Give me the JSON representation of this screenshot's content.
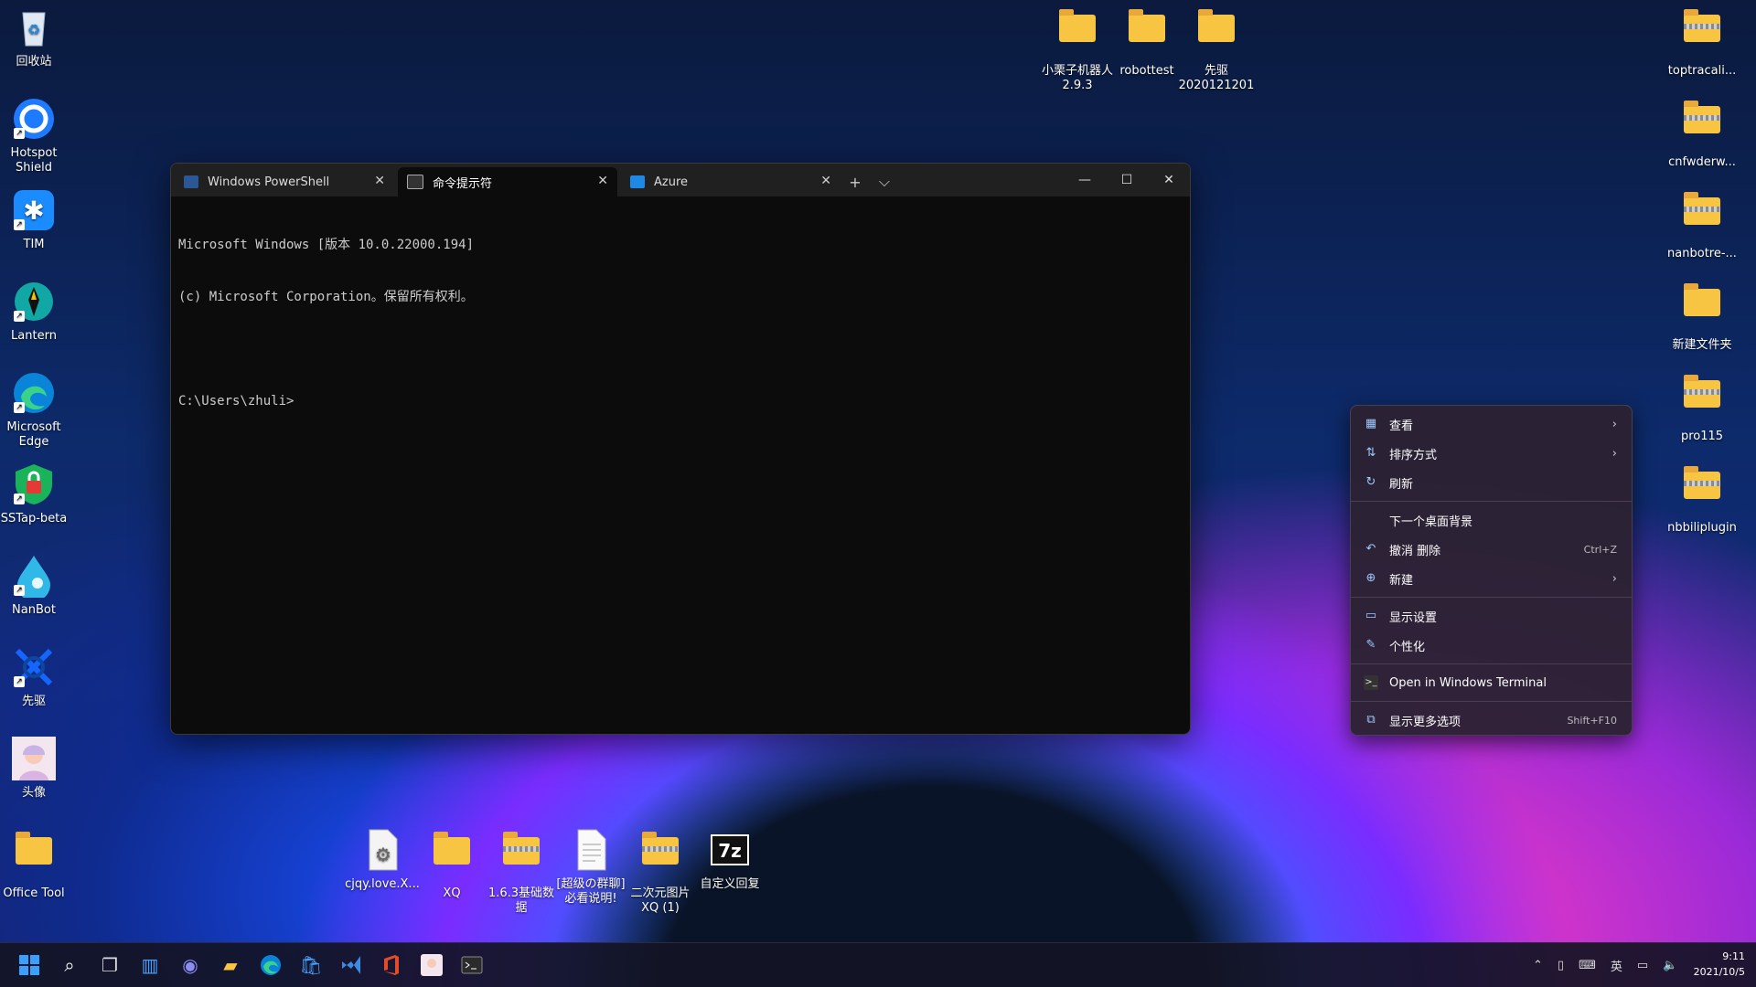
{
  "desktop": {
    "left_icons": [
      {
        "label": "回收站",
        "icon": "recycle-bin-icon"
      },
      {
        "label": "Hotspot\nShield",
        "icon": "hotspot-shield-icon"
      },
      {
        "label": "TIM",
        "icon": "tim-icon"
      },
      {
        "label": "Lantern",
        "icon": "lantern-icon"
      },
      {
        "label": "Microsoft\nEdge",
        "icon": "edge-icon"
      },
      {
        "label": "SSTap-beta",
        "icon": "sstap-icon"
      },
      {
        "label": "NanBot",
        "icon": "nanbot-icon"
      },
      {
        "label": "先驱",
        "icon": "xianqu-icon"
      },
      {
        "label": "头像",
        "icon": "avatar-image-icon"
      },
      {
        "label": "Office Tool",
        "icon": "folder-icon"
      }
    ],
    "top_icons": [
      {
        "label": "小栗子机器人\n2.9.3",
        "icon": "folder-icon"
      },
      {
        "label": "robottest",
        "icon": "folder-icon"
      },
      {
        "label": "先驱\n2020121201",
        "icon": "folder-icon"
      }
    ],
    "right_icons": [
      {
        "label": "toptracali...",
        "icon": "zip-folder-icon"
      },
      {
        "label": "cnfwderw...",
        "icon": "zip-folder-icon"
      },
      {
        "label": "nanbotre-...",
        "icon": "zip-folder-icon"
      },
      {
        "label": "新建文件夹",
        "icon": "folder-icon"
      },
      {
        "label": "pro115",
        "icon": "zip-folder-icon"
      },
      {
        "label": "nbbiliplugin",
        "icon": "zip-folder-icon"
      }
    ],
    "bottom_icons": [
      {
        "label": "cjqy.love.X...",
        "icon": "settings-file-icon"
      },
      {
        "label": "XQ",
        "icon": "folder-icon"
      },
      {
        "label": "1.6.3基础数\n据",
        "icon": "zip-folder-icon"
      },
      {
        "label": "[超级の群聊]\n必看说明!",
        "icon": "text-file-icon"
      },
      {
        "label": "二次元图片\nXQ (1)",
        "icon": "zip-folder-icon"
      },
      {
        "label": "自定义回复",
        "icon": "7zip-icon"
      }
    ]
  },
  "terminal": {
    "tabs": [
      {
        "label": "Windows PowerShell",
        "icon": "powershell-icon"
      },
      {
        "label": "命令提示符",
        "icon": "cmd-icon"
      },
      {
        "label": "Azure",
        "icon": "azure-icon"
      }
    ],
    "new_tab_glyph": "+",
    "dropdown_glyph": "⌵",
    "window_controls": {
      "minimize": "—",
      "maximize": "☐",
      "close": "✕"
    },
    "console_lines": [
      "Microsoft Windows [版本 10.0.22000.194]",
      "(c) Microsoft Corporation。保留所有权利。",
      "",
      "C:\\Users\\zhuli>"
    ]
  },
  "context_menu": {
    "items": [
      {
        "label": "查看",
        "icon": "grid-icon",
        "submenu": true
      },
      {
        "label": "排序方式",
        "icon": "sort-icon",
        "submenu": true
      },
      {
        "label": "刷新",
        "icon": "refresh-icon"
      },
      {
        "label": "下一个桌面背景",
        "icon": ""
      },
      {
        "label": "撤消 删除",
        "icon": "undo-icon",
        "accelerator": "Ctrl+Z"
      },
      {
        "label": "新建",
        "icon": "plus-circle-icon",
        "submenu": true
      },
      {
        "label": "显示设置",
        "icon": "display-icon"
      },
      {
        "label": "个性化",
        "icon": "brush-icon"
      },
      {
        "label": "Open in Windows Terminal",
        "icon": "terminal-icon"
      },
      {
        "label": "显示更多选项",
        "icon": "more-options-icon",
        "accelerator": "Shift+F10"
      }
    ]
  },
  "taskbar": {
    "tray_lang": "英",
    "time": "9:11",
    "date": "2021/10/5"
  }
}
